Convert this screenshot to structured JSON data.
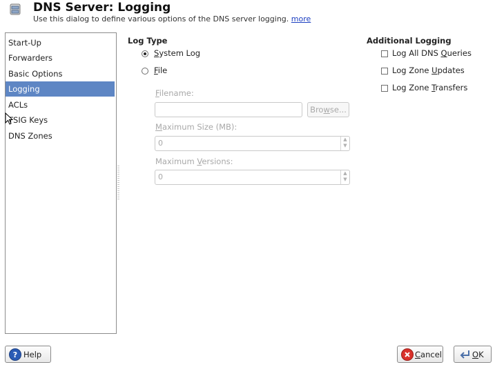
{
  "header": {
    "title": "DNS Server: Logging",
    "subtitle": "Use this dialog to define various options of the DNS server logging.",
    "more_link": "more"
  },
  "sidebar": {
    "items": [
      {
        "label": "Start-Up"
      },
      {
        "label": "Forwarders"
      },
      {
        "label": "Basic Options"
      },
      {
        "label": "Logging",
        "selected": true
      },
      {
        "label": "ACLs"
      },
      {
        "label": "TSIG Keys"
      },
      {
        "label": "DNS Zones"
      }
    ]
  },
  "log_type": {
    "title": "Log Type",
    "system_log_label_access": "S",
    "system_log_label_rest": "ystem Log",
    "file_label_access": "F",
    "file_label_rest": "ile",
    "selected": "System Log",
    "filename_label_access": "F",
    "filename_label_rest": "ilename:",
    "filename_value": "",
    "browse_label_pre": "Bro",
    "browse_label_access": "w",
    "browse_label_rest": "se...",
    "max_size_label_access": "M",
    "max_size_label_rest": "aximum Size (MB):",
    "max_size_value": "0",
    "max_versions_label_pre": "Maximum ",
    "max_versions_label_access": "V",
    "max_versions_label_rest": "ersions:",
    "max_versions_value": "0"
  },
  "additional": {
    "title": "Additional Logging",
    "queries_pre": "Log All DNS ",
    "queries_access": "Q",
    "queries_rest": "ueries",
    "updates_pre": "Log Zone ",
    "updates_access": "U",
    "updates_rest": "pdates",
    "transfers_pre": "Log Zone ",
    "transfers_access": "T",
    "transfers_rest": "ransfers"
  },
  "footer": {
    "help_label": "Help",
    "cancel_access": "C",
    "cancel_rest": "ancel",
    "ok_access": "O",
    "ok_rest": "K"
  },
  "colors": {
    "selection": "#5e86c4",
    "link": "#1a3dc0",
    "cancel_icon": "#d9322b",
    "help_icon": "#2a5bb5"
  },
  "icons": [
    "dns-server-icon",
    "help-icon",
    "cancel-icon",
    "ok-icon",
    "mouse-pointer-icon"
  ]
}
